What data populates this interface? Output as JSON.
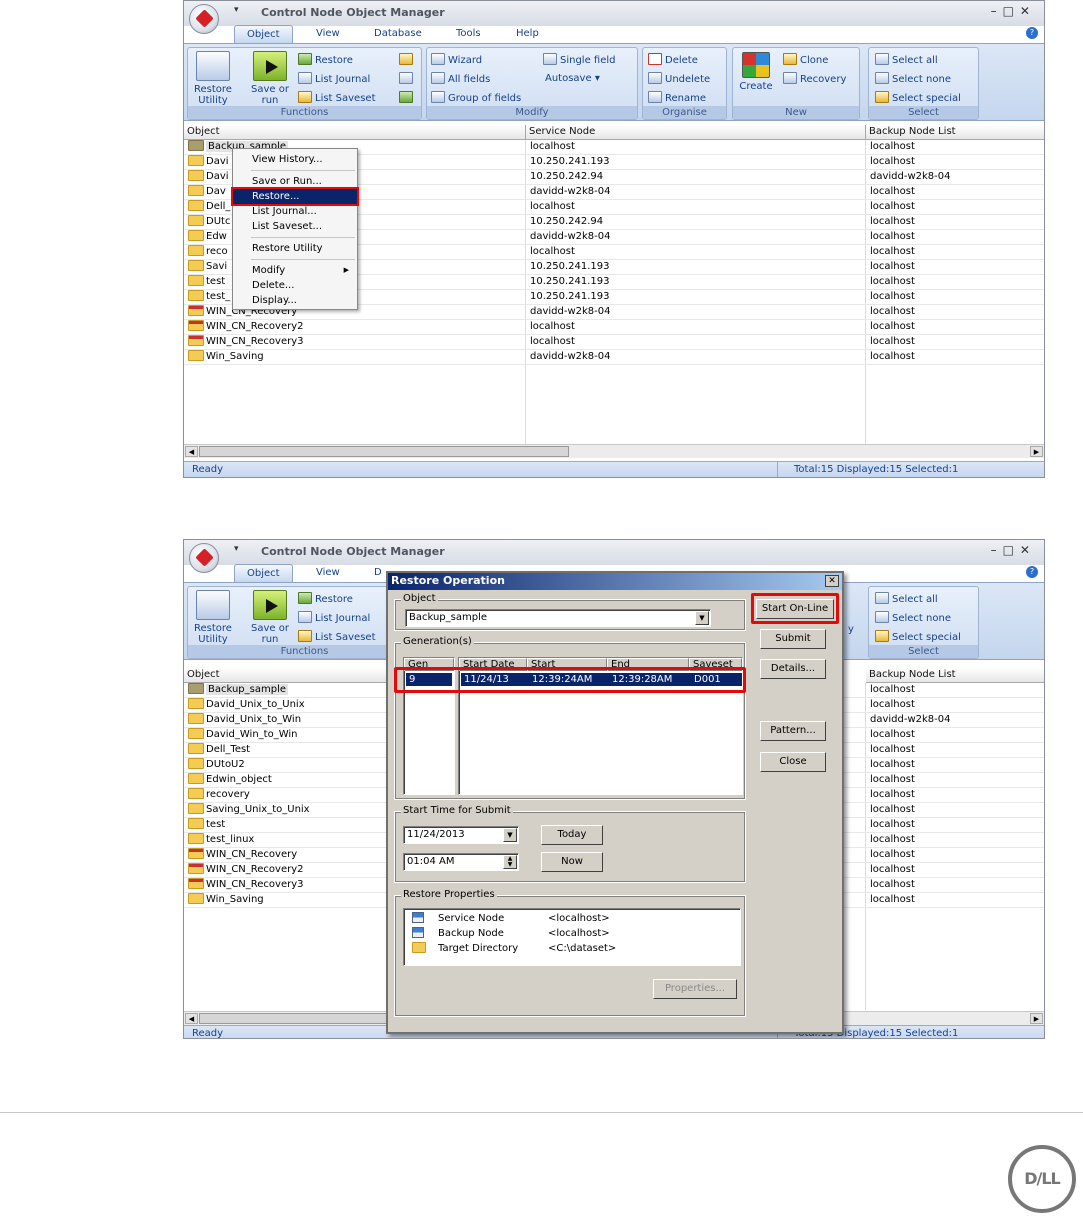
{
  "app": {
    "title": "Control Node Object Manager",
    "qat": "▾"
  },
  "tabs": [
    "Object",
    "View",
    "Database",
    "Tools",
    "Help"
  ],
  "tabs2": {
    "object": "Object",
    "view": "View",
    "truncated": "D"
  },
  "ribbon": {
    "functions": {
      "label": "Functions",
      "restore_utility": "Restore Utility",
      "save_or_run": "Save or run",
      "restore": "Restore",
      "list_journal": "List Journal",
      "list_saveset": "List Saveset"
    },
    "modify": {
      "label": "Modify",
      "wizard": "Wizard",
      "all_fields": "All fields",
      "group_of_fields": "Group of fields",
      "single_field": "Single field",
      "autosave": "Autosave"
    },
    "organise": {
      "label": "Organise",
      "delete": "Delete",
      "undelete": "Undelete",
      "rename": "Rename"
    },
    "new": {
      "label": "New",
      "create": "Create",
      "clone": "Clone",
      "recovery": "Recovery",
      "truncated_recovery": "y"
    },
    "select": {
      "label": "Select",
      "select_all": "Select all",
      "select_none": "Select none",
      "select_special": "Select special"
    }
  },
  "grid": {
    "headers": [
      "Object",
      "Service Node",
      "Backup Node List"
    ],
    "rows1": [
      {
        "obj": "Backup_sample",
        "svc": "localhost",
        "bkp": "localhost",
        "icon": "sel"
      },
      {
        "obj": "Davi",
        "svc": "10.250.241.193",
        "bkp": "localhost",
        "icon": "normal"
      },
      {
        "obj": "Davi",
        "svc": "10.250.242.94",
        "bkp": "davidd-w2k8-04",
        "icon": "normal"
      },
      {
        "obj": "Dav",
        "svc": "davidd-w2k8-04",
        "bkp": "localhost",
        "icon": "normal"
      },
      {
        "obj": "Dell_",
        "svc": "localhost",
        "bkp": "localhost",
        "icon": "normal"
      },
      {
        "obj": "DUtc",
        "svc": "10.250.242.94",
        "bkp": "localhost",
        "icon": "normal"
      },
      {
        "obj": "Edw",
        "svc": "davidd-w2k8-04",
        "bkp": "localhost",
        "icon": "normal"
      },
      {
        "obj": "reco",
        "svc": "localhost",
        "bkp": "localhost",
        "icon": "normal"
      },
      {
        "obj": "Savi",
        "svc": "10.250.241.193",
        "bkp": "localhost",
        "icon": "normal"
      },
      {
        "obj": "test",
        "svc": "10.250.241.193",
        "bkp": "localhost",
        "icon": "normal"
      },
      {
        "obj": "test_",
        "svc": "10.250.241.193",
        "bkp": "localhost",
        "icon": "normal"
      },
      {
        "obj": "WIN_CN_Recovery",
        "svc": "davidd-w2k8-04",
        "bkp": "localhost",
        "icon": "red"
      },
      {
        "obj": "WIN_CN_Recovery2",
        "svc": "localhost",
        "bkp": "localhost",
        "icon": "red"
      },
      {
        "obj": "WIN_CN_Recovery3",
        "svc": "localhost",
        "bkp": "localhost",
        "icon": "red"
      },
      {
        "obj": "Win_Saving",
        "svc": "davidd-w2k8-04",
        "bkp": "localhost",
        "icon": "normal"
      }
    ],
    "rows2": [
      {
        "obj": "Backup_sample",
        "bkp": "localhost",
        "icon": "sel"
      },
      {
        "obj": "David_Unix_to_Unix",
        "bkp": "localhost",
        "icon": "normal"
      },
      {
        "obj": "David_Unix_to_Win",
        "bkp": "davidd-w2k8-04",
        "icon": "normal"
      },
      {
        "obj": "David_Win_to_Win",
        "bkp": "localhost",
        "icon": "normal"
      },
      {
        "obj": "Dell_Test",
        "bkp": "localhost",
        "icon": "normal"
      },
      {
        "obj": "DUtoU2",
        "bkp": "localhost",
        "icon": "normal"
      },
      {
        "obj": "Edwin_object",
        "bkp": "localhost",
        "icon": "normal"
      },
      {
        "obj": "recovery",
        "bkp": "localhost",
        "icon": "normal"
      },
      {
        "obj": "Saving_Unix_to_Unix",
        "bkp": "localhost",
        "icon": "normal"
      },
      {
        "obj": "test",
        "bkp": "localhost",
        "icon": "normal"
      },
      {
        "obj": "test_linux",
        "bkp": "localhost",
        "icon": "normal"
      },
      {
        "obj": "WIN_CN_Recovery",
        "bkp": "localhost",
        "icon": "red"
      },
      {
        "obj": "WIN_CN_Recovery2",
        "bkp": "localhost",
        "icon": "red"
      },
      {
        "obj": "WIN_CN_Recovery3",
        "bkp": "localhost",
        "icon": "red"
      },
      {
        "obj": "Win_Saving",
        "bkp": "localhost",
        "icon": "normal"
      }
    ]
  },
  "context_menu": {
    "view_history": "View History...",
    "save_or_run": "Save or Run...",
    "restore": "Restore...",
    "list_journal": "List Journal...",
    "list_saveset": "List Saveset...",
    "restore_utility": "Restore Utility",
    "modify": "Modify",
    "delete": "Delete...",
    "display": "Display..."
  },
  "status": {
    "ready": "Ready",
    "totals": "Total:15  Displayed:15  Selected:1"
  },
  "dialog": {
    "title": "Restore Operation",
    "object_label": "Object",
    "object_value": "Backup_sample",
    "generations_label": "Generation(s)",
    "gen_header": "Gen",
    "cols": [
      "Start Date",
      "Start",
      "End",
      "Saveset"
    ],
    "gen_value": "9",
    "row": {
      "date": "11/24/13",
      "start": "12:39:24AM",
      "end": "12:39:28AM",
      "saveset": "D001"
    },
    "start_time_label": "Start Time for Submit",
    "date_value": "11/24/2013",
    "time_value": "01:04 AM",
    "today": "Today",
    "now": "Now",
    "restore_props_label": "Restore Properties",
    "props": [
      {
        "name": "Service Node",
        "value": "<localhost>"
      },
      {
        "name": "Backup Node",
        "value": "<localhost>"
      },
      {
        "name": "Target Directory",
        "value": "<C:\\dataset>"
      }
    ],
    "properties_btn": "Properties...",
    "start_online": "Start On-Line",
    "submit": "Submit",
    "details": "Details...",
    "pattern": "Pattern...",
    "close": "Close"
  },
  "logo": "D∕LL"
}
